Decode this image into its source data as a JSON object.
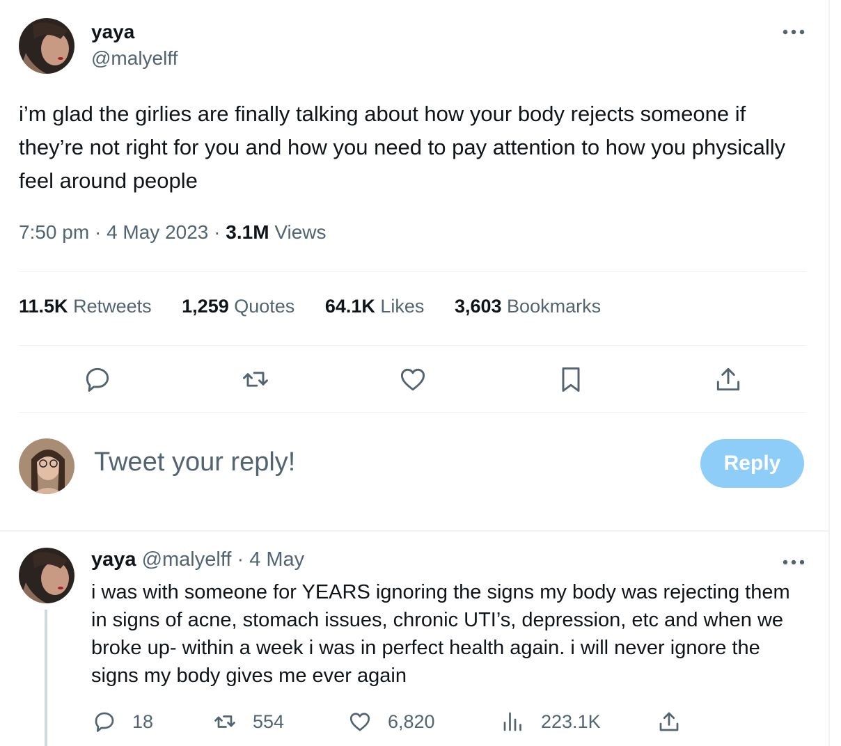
{
  "main_tweet": {
    "author_name": "yaya",
    "author_handle": "@malyelff",
    "text": "i’m glad the girlies are finally talking about how your body rejects someone if they’re not right for you and how you need to pay attention to how you physically feel around people",
    "time": "7:50 pm",
    "date": "4 May 2023",
    "views_count": "3.1M",
    "views_label": "Views",
    "stats": [
      {
        "value": "11.5K",
        "label": "Retweets"
      },
      {
        "value": "1,259",
        "label": "Quotes"
      },
      {
        "value": "64.1K",
        "label": "Likes"
      },
      {
        "value": "3,603",
        "label": "Bookmarks"
      }
    ]
  },
  "composer": {
    "placeholder": "Tweet your reply!",
    "button_label": "Reply"
  },
  "reply_tweet": {
    "author_name": "yaya",
    "author_handle": "@malyelff",
    "date": "4 May",
    "text": "i was with someone for YEARS ignoring the signs my body was rejecting them in signs of acne, stomach issues, chronic UTI’s, depression, etc and when we broke up- within a week i was in perfect health again. i will never ignore the signs my body gives me ever again",
    "replies": "18",
    "retweets": "554",
    "likes": "6,820",
    "views": "223.1K"
  },
  "colors": {
    "text": "#0f1419",
    "secondary": "#536471",
    "reply_button": "#8ecdf8",
    "border": "#eff3f4"
  }
}
